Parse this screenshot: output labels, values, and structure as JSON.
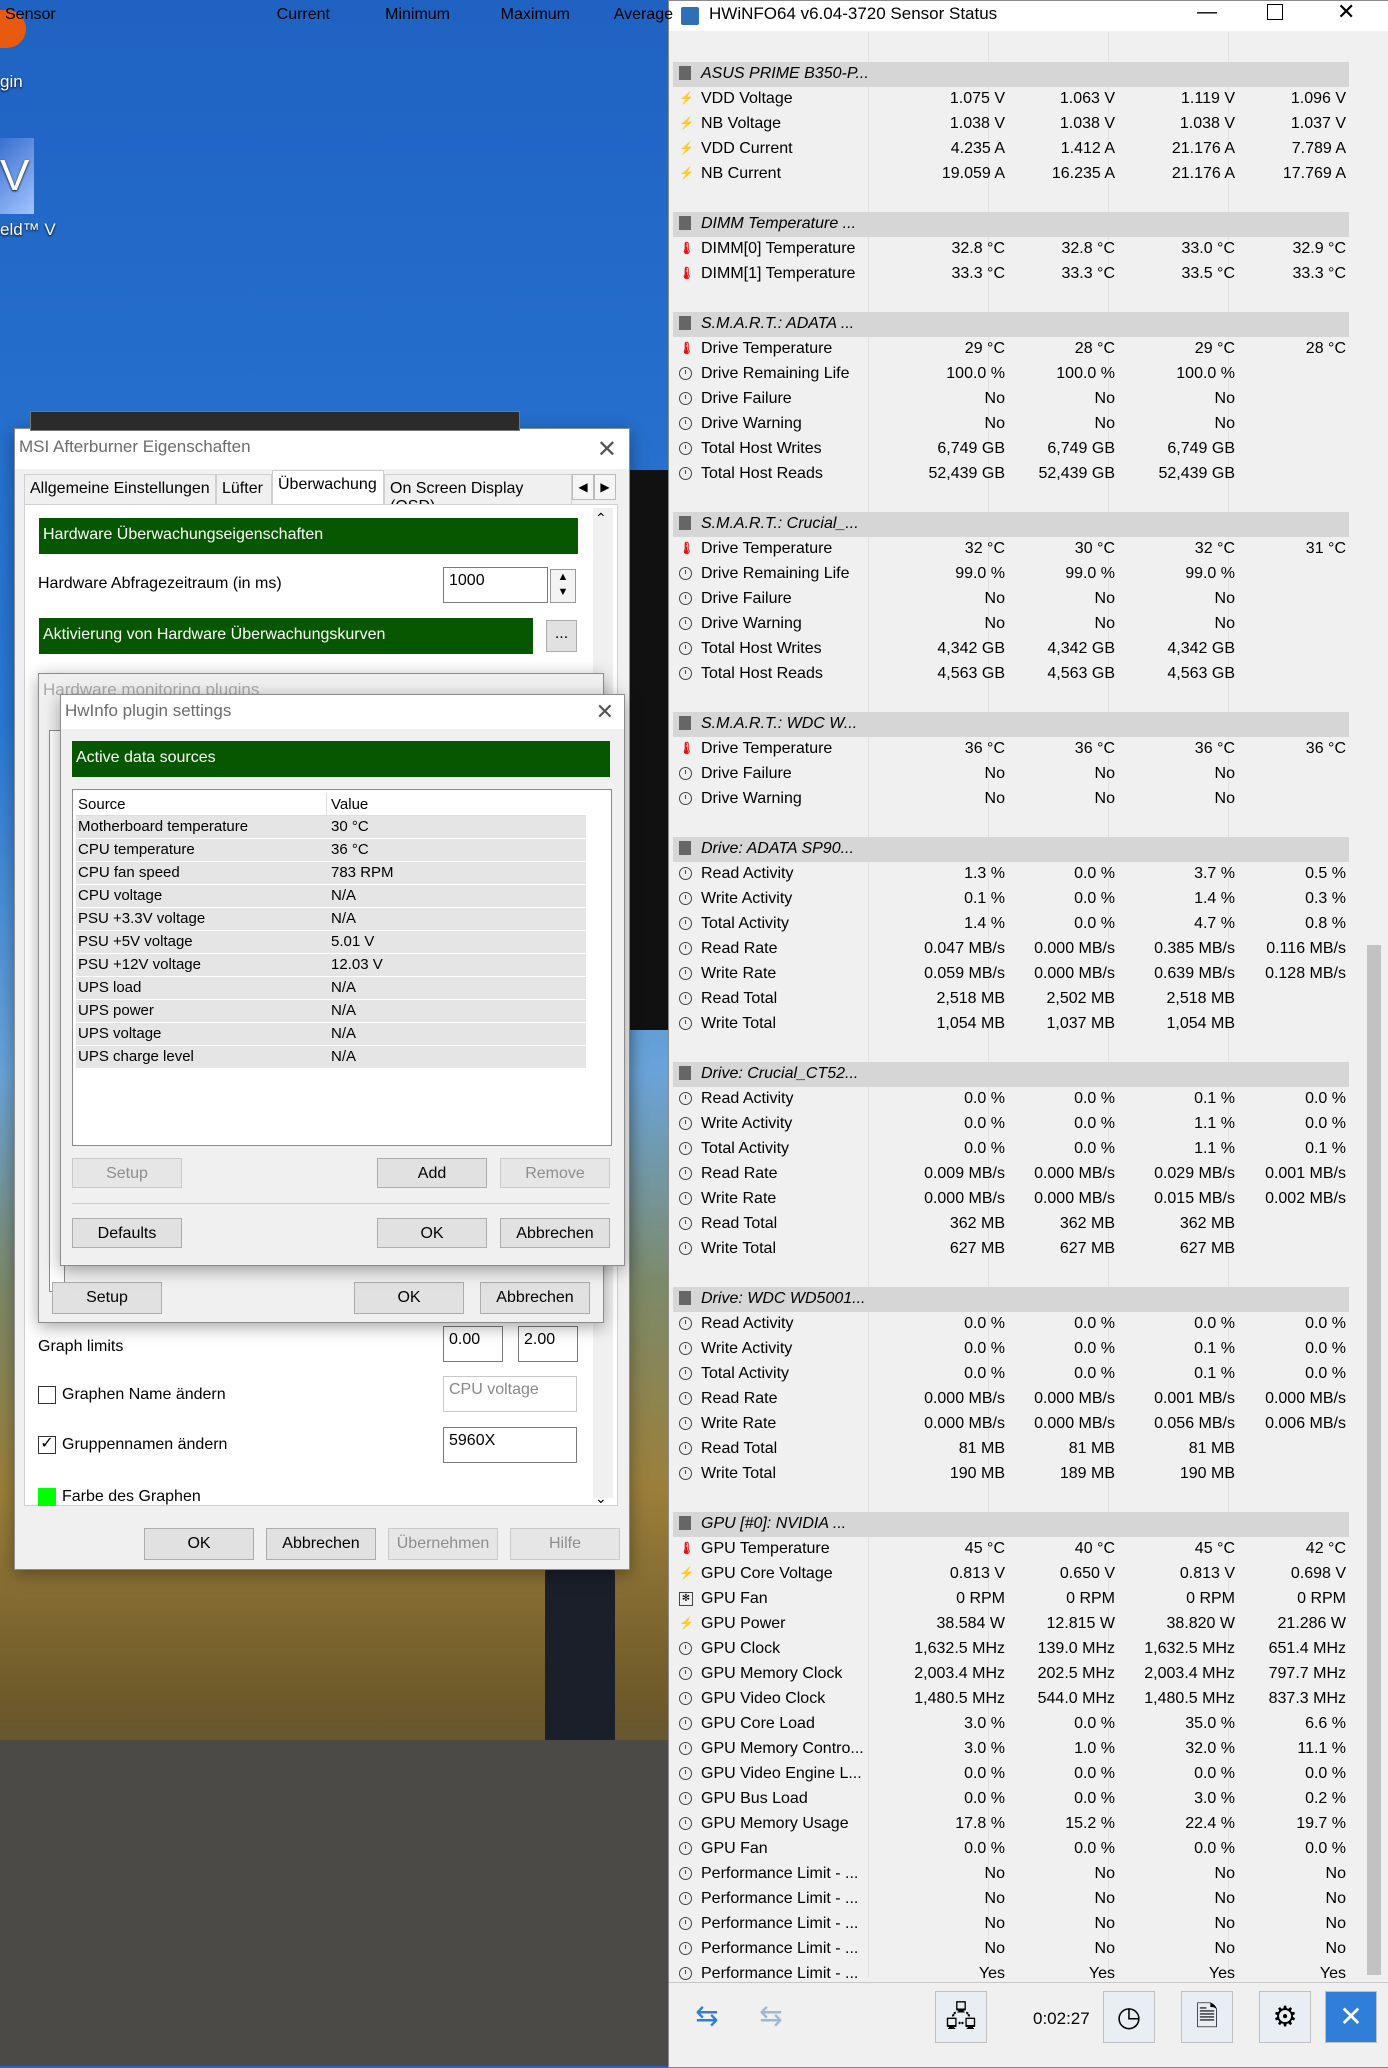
{
  "desktop": {
    "icons": [
      {
        "label": "gin",
        "icon": "app-icon"
      },
      {
        "label": "eld™ V",
        "icon": "game-icon"
      }
    ]
  },
  "hwinfo": {
    "title": "HWiNFO64 v6.04-3720 Sensor Status",
    "columns": [
      "Sensor",
      "Current",
      "Minimum",
      "Maximum",
      "Average"
    ],
    "rows": [
      {
        "type": "group",
        "name": "ASUS PRIME B350-P..."
      },
      {
        "icon": "bolt",
        "name": "VDD Voltage",
        "cur": "1.075 V",
        "min": "1.063 V",
        "max": "1.119 V",
        "avg": "1.096 V"
      },
      {
        "icon": "bolt",
        "name": "NB Voltage",
        "cur": "1.038 V",
        "min": "1.038 V",
        "max": "1.038 V",
        "avg": "1.037 V"
      },
      {
        "icon": "bolt",
        "name": "VDD Current",
        "cur": "4.235 A",
        "min": "1.412 A",
        "max": "21.176 A",
        "avg": "7.789 A"
      },
      {
        "icon": "bolt",
        "name": "NB Current",
        "cur": "19.059 A",
        "min": "16.235 A",
        "max": "21.176 A",
        "avg": "17.769 A"
      },
      {
        "type": "blank"
      },
      {
        "type": "group",
        "name": "DIMM Temperature ..."
      },
      {
        "icon": "therm",
        "name": "DIMM[0] Temperature",
        "cur": "32.8 °C",
        "min": "32.8 °C",
        "max": "33.0 °C",
        "avg": "32.9 °C"
      },
      {
        "icon": "therm",
        "name": "DIMM[1] Temperature",
        "cur": "33.3 °C",
        "min": "33.3 °C",
        "max": "33.5 °C",
        "avg": "33.3 °C"
      },
      {
        "type": "blank"
      },
      {
        "type": "group",
        "name": "S.M.A.R.T.: ADATA ..."
      },
      {
        "icon": "therm",
        "name": "Drive Temperature",
        "cur": "29 °C",
        "min": "28 °C",
        "max": "29 °C",
        "avg": "28 °C"
      },
      {
        "icon": "clock",
        "name": "Drive Remaining Life",
        "cur": "100.0 %",
        "min": "100.0 %",
        "max": "100.0 %",
        "avg": ""
      },
      {
        "icon": "clock",
        "name": "Drive Failure",
        "cur": "No",
        "min": "No",
        "max": "No",
        "avg": ""
      },
      {
        "icon": "clock",
        "name": "Drive Warning",
        "cur": "No",
        "min": "No",
        "max": "No",
        "avg": ""
      },
      {
        "icon": "clock",
        "name": "Total Host Writes",
        "cur": "6,749 GB",
        "min": "6,749 GB",
        "max": "6,749 GB",
        "avg": ""
      },
      {
        "icon": "clock",
        "name": "Total Host Reads",
        "cur": "52,439 GB",
        "min": "52,439 GB",
        "max": "52,439 GB",
        "avg": ""
      },
      {
        "type": "blank"
      },
      {
        "type": "group",
        "name": "S.M.A.R.T.: Crucial_..."
      },
      {
        "icon": "therm",
        "name": "Drive Temperature",
        "cur": "32 °C",
        "min": "30 °C",
        "max": "32 °C",
        "avg": "31 °C"
      },
      {
        "icon": "clock",
        "name": "Drive Remaining Life",
        "cur": "99.0 %",
        "min": "99.0 %",
        "max": "99.0 %",
        "avg": ""
      },
      {
        "icon": "clock",
        "name": "Drive Failure",
        "cur": "No",
        "min": "No",
        "max": "No",
        "avg": ""
      },
      {
        "icon": "clock",
        "name": "Drive Warning",
        "cur": "No",
        "min": "No",
        "max": "No",
        "avg": ""
      },
      {
        "icon": "clock",
        "name": "Total Host Writes",
        "cur": "4,342 GB",
        "min": "4,342 GB",
        "max": "4,342 GB",
        "avg": ""
      },
      {
        "icon": "clock",
        "name": "Total Host Reads",
        "cur": "4,563 GB",
        "min": "4,563 GB",
        "max": "4,563 GB",
        "avg": ""
      },
      {
        "type": "blank"
      },
      {
        "type": "group",
        "name": "S.M.A.R.T.: WDC W..."
      },
      {
        "icon": "therm",
        "name": "Drive Temperature",
        "cur": "36 °C",
        "min": "36 °C",
        "max": "36 °C",
        "avg": "36 °C"
      },
      {
        "icon": "clock",
        "name": "Drive Failure",
        "cur": "No",
        "min": "No",
        "max": "No",
        "avg": ""
      },
      {
        "icon": "clock",
        "name": "Drive Warning",
        "cur": "No",
        "min": "No",
        "max": "No",
        "avg": ""
      },
      {
        "type": "blank"
      },
      {
        "type": "group",
        "name": "Drive: ADATA SP90..."
      },
      {
        "icon": "clock",
        "name": "Read Activity",
        "cur": "1.3 %",
        "min": "0.0 %",
        "max": "3.7 %",
        "avg": "0.5 %"
      },
      {
        "icon": "clock",
        "name": "Write Activity",
        "cur": "0.1 %",
        "min": "0.0 %",
        "max": "1.4 %",
        "avg": "0.3 %"
      },
      {
        "icon": "clock",
        "name": "Total Activity",
        "cur": "1.4 %",
        "min": "0.0 %",
        "max": "4.7 %",
        "avg": "0.8 %"
      },
      {
        "icon": "clock",
        "name": "Read Rate",
        "cur": "0.047 MB/s",
        "min": "0.000 MB/s",
        "max": "0.385 MB/s",
        "avg": "0.116 MB/s"
      },
      {
        "icon": "clock",
        "name": "Write Rate",
        "cur": "0.059 MB/s",
        "min": "0.000 MB/s",
        "max": "0.639 MB/s",
        "avg": "0.128 MB/s"
      },
      {
        "icon": "clock",
        "name": "Read Total",
        "cur": "2,518 MB",
        "min": "2,502 MB",
        "max": "2,518 MB",
        "avg": ""
      },
      {
        "icon": "clock",
        "name": "Write Total",
        "cur": "1,054 MB",
        "min": "1,037 MB",
        "max": "1,054 MB",
        "avg": ""
      },
      {
        "type": "blank"
      },
      {
        "type": "group",
        "name": "Drive: Crucial_CT52..."
      },
      {
        "icon": "clock",
        "name": "Read Activity",
        "cur": "0.0 %",
        "min": "0.0 %",
        "max": "0.1 %",
        "avg": "0.0 %"
      },
      {
        "icon": "clock",
        "name": "Write Activity",
        "cur": "0.0 %",
        "min": "0.0 %",
        "max": "1.1 %",
        "avg": "0.0 %"
      },
      {
        "icon": "clock",
        "name": "Total Activity",
        "cur": "0.0 %",
        "min": "0.0 %",
        "max": "1.1 %",
        "avg": "0.1 %"
      },
      {
        "icon": "clock",
        "name": "Read Rate",
        "cur": "0.009 MB/s",
        "min": "0.000 MB/s",
        "max": "0.029 MB/s",
        "avg": "0.001 MB/s"
      },
      {
        "icon": "clock",
        "name": "Write Rate",
        "cur": "0.000 MB/s",
        "min": "0.000 MB/s",
        "max": "0.015 MB/s",
        "avg": "0.002 MB/s"
      },
      {
        "icon": "clock",
        "name": "Read Total",
        "cur": "362 MB",
        "min": "362 MB",
        "max": "362 MB",
        "avg": ""
      },
      {
        "icon": "clock",
        "name": "Write Total",
        "cur": "627 MB",
        "min": "627 MB",
        "max": "627 MB",
        "avg": ""
      },
      {
        "type": "blank"
      },
      {
        "type": "group",
        "name": "Drive: WDC WD5001..."
      },
      {
        "icon": "clock",
        "name": "Read Activity",
        "cur": "0.0 %",
        "min": "0.0 %",
        "max": "0.0 %",
        "avg": "0.0 %"
      },
      {
        "icon": "clock",
        "name": "Write Activity",
        "cur": "0.0 %",
        "min": "0.0 %",
        "max": "0.1 %",
        "avg": "0.0 %"
      },
      {
        "icon": "clock",
        "name": "Total Activity",
        "cur": "0.0 %",
        "min": "0.0 %",
        "max": "0.1 %",
        "avg": "0.0 %"
      },
      {
        "icon": "clock",
        "name": "Read Rate",
        "cur": "0.000 MB/s",
        "min": "0.000 MB/s",
        "max": "0.001 MB/s",
        "avg": "0.000 MB/s"
      },
      {
        "icon": "clock",
        "name": "Write Rate",
        "cur": "0.000 MB/s",
        "min": "0.000 MB/s",
        "max": "0.056 MB/s",
        "avg": "0.006 MB/s"
      },
      {
        "icon": "clock",
        "name": "Read Total",
        "cur": "81 MB",
        "min": "81 MB",
        "max": "81 MB",
        "avg": ""
      },
      {
        "icon": "clock",
        "name": "Write Total",
        "cur": "190 MB",
        "min": "189 MB",
        "max": "190 MB",
        "avg": ""
      },
      {
        "type": "blank"
      },
      {
        "type": "group",
        "name": "GPU [#0]: NVIDIA ..."
      },
      {
        "icon": "therm",
        "name": "GPU Temperature",
        "cur": "45 °C",
        "min": "40 °C",
        "max": "45 °C",
        "avg": "42 °C"
      },
      {
        "icon": "bolt",
        "name": "GPU Core Voltage",
        "cur": "0.813 V",
        "min": "0.650 V",
        "max": "0.813 V",
        "avg": "0.698 V"
      },
      {
        "icon": "fan",
        "name": "GPU Fan",
        "cur": "0 RPM",
        "min": "0 RPM",
        "max": "0 RPM",
        "avg": "0 RPM"
      },
      {
        "icon": "bolt",
        "name": "GPU Power",
        "cur": "38.584 W",
        "min": "12.815 W",
        "max": "38.820 W",
        "avg": "21.286 W"
      },
      {
        "icon": "clock",
        "name": "GPU Clock",
        "cur": "1,632.5 MHz",
        "min": "139.0 MHz",
        "max": "1,632.5 MHz",
        "avg": "651.4 MHz"
      },
      {
        "icon": "clock",
        "name": "GPU Memory Clock",
        "cur": "2,003.4 MHz",
        "min": "202.5 MHz",
        "max": "2,003.4 MHz",
        "avg": "797.7 MHz"
      },
      {
        "icon": "clock",
        "name": "GPU Video Clock",
        "cur": "1,480.5 MHz",
        "min": "544.0 MHz",
        "max": "1,480.5 MHz",
        "avg": "837.3 MHz"
      },
      {
        "icon": "clock",
        "name": "GPU Core Load",
        "cur": "3.0 %",
        "min": "0.0 %",
        "max": "35.0 %",
        "avg": "6.6 %"
      },
      {
        "icon": "clock",
        "name": "GPU Memory Contro...",
        "cur": "3.0 %",
        "min": "1.0 %",
        "max": "32.0 %",
        "avg": "11.1 %"
      },
      {
        "icon": "clock",
        "name": "GPU Video Engine L...",
        "cur": "0.0 %",
        "min": "0.0 %",
        "max": "0.0 %",
        "avg": "0.0 %"
      },
      {
        "icon": "clock",
        "name": "GPU Bus Load",
        "cur": "0.0 %",
        "min": "0.0 %",
        "max": "3.0 %",
        "avg": "0.2 %"
      },
      {
        "icon": "clock",
        "name": "GPU Memory Usage",
        "cur": "17.8 %",
        "min": "15.2 %",
        "max": "22.4 %",
        "avg": "19.7 %"
      },
      {
        "icon": "clock",
        "name": "GPU Fan",
        "cur": "0.0 %",
        "min": "0.0 %",
        "max": "0.0 %",
        "avg": "0.0 %"
      },
      {
        "icon": "clock",
        "name": "Performance Limit - ...",
        "cur": "No",
        "min": "No",
        "max": "No",
        "avg": "No"
      },
      {
        "icon": "clock",
        "name": "Performance Limit - ...",
        "cur": "No",
        "min": "No",
        "max": "No",
        "avg": "No"
      },
      {
        "icon": "clock",
        "name": "Performance Limit - ...",
        "cur": "No",
        "min": "No",
        "max": "No",
        "avg": "No"
      },
      {
        "icon": "clock",
        "name": "Performance Limit - ...",
        "cur": "No",
        "min": "No",
        "max": "No",
        "avg": "No"
      },
      {
        "icon": "clock",
        "name": "Performance Limit - ...",
        "cur": "Yes",
        "min": "Yes",
        "max": "Yes",
        "avg": "Yes"
      }
    ],
    "elapsed": "0:02:27"
  },
  "msi": {
    "title": "MSI Afterburner Eigenschaften",
    "tabs": [
      "Allgemeine Einstellungen",
      "Lüfter",
      "Überwachung",
      "On Screen Display (OSD)"
    ],
    "section_props": "Hardware Überwachungseigenschaften",
    "poll_label": "Hardware Abfragezeitraum (in ms)",
    "poll_value": "1000",
    "section_graphs": "Aktivierung von Hardware Überwachungskurven",
    "more_label": "...",
    "graph_limits_label": "Graph limits",
    "graph_min": "0.00",
    "graph_max": "2.00",
    "rename_graph_label": "Graphen Name ändern",
    "rename_graph_placeholder": "CPU voltage",
    "rename_group_label": "Gruppennamen ändern",
    "rename_group_value": "5960X",
    "graph_color_label": "Farbe des Graphen",
    "graph_color": "#00ff00",
    "ok": "OK",
    "cancel": "Abbrechen",
    "apply": "Übernehmen",
    "help": "Hilfe"
  },
  "hmp": {
    "title": "Hardware monitoring plugins",
    "setup": "Setup",
    "ok": "OK",
    "cancel": "Abbrechen"
  },
  "hps": {
    "title": "HwInfo plugin settings",
    "section": "Active data sources",
    "col_source": "Source",
    "col_value": "Value",
    "sources": [
      {
        "source": "Motherboard temperature",
        "value": "30 °C"
      },
      {
        "source": "CPU temperature",
        "value": "36 °C"
      },
      {
        "source": "CPU fan speed",
        "value": "783 RPM"
      },
      {
        "source": "CPU voltage",
        "value": "N/A"
      },
      {
        "source": "PSU +3.3V voltage",
        "value": "N/A"
      },
      {
        "source": "PSU +5V voltage",
        "value": "5.01 V"
      },
      {
        "source": "PSU +12V voltage",
        "value": "12.03 V"
      },
      {
        "source": "UPS load",
        "value": "N/A"
      },
      {
        "source": "UPS power",
        "value": "N/A"
      },
      {
        "source": "UPS voltage",
        "value": "N/A"
      },
      {
        "source": "UPS charge level",
        "value": "N/A"
      }
    ],
    "setup": "Setup",
    "add": "Add",
    "remove": "Remove",
    "defaults": "Defaults",
    "ok": "OK",
    "cancel": "Abbrechen"
  }
}
